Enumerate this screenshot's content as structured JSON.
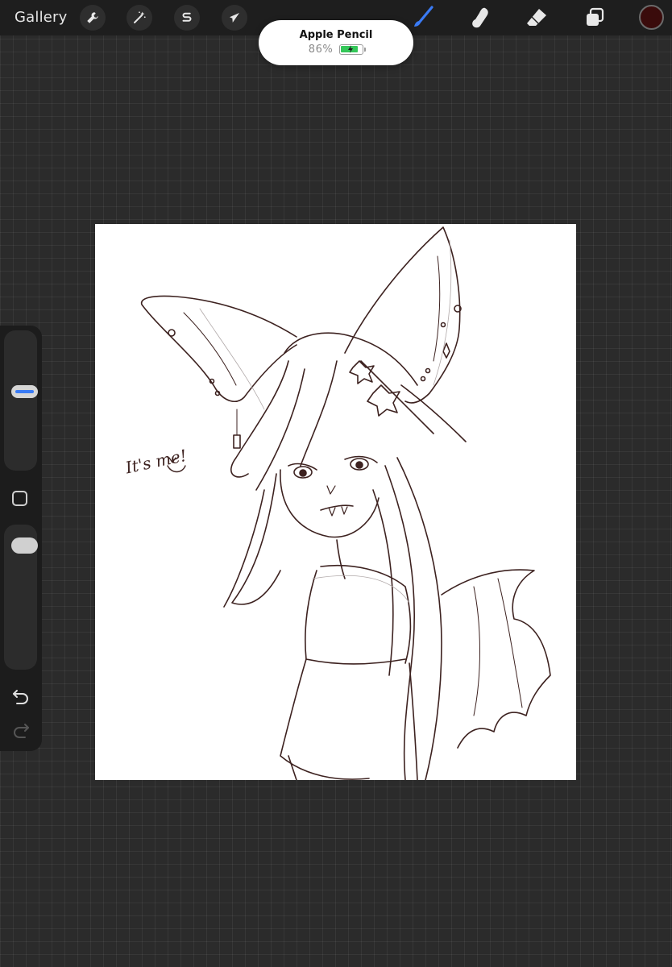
{
  "topbar": {
    "gallery_label": "Gallery",
    "left_tools": [
      {
        "name": "actions",
        "icon": "wrench-icon"
      },
      {
        "name": "adjustments",
        "icon": "magic-wand-icon"
      },
      {
        "name": "selection",
        "icon": "selection-s-icon"
      },
      {
        "name": "transform",
        "icon": "arrow-cursor-icon"
      }
    ],
    "right_tools": [
      {
        "name": "brush",
        "icon": "brush-icon",
        "active": true
      },
      {
        "name": "smudge",
        "icon": "smudge-finger-icon"
      },
      {
        "name": "eraser",
        "icon": "eraser-icon"
      },
      {
        "name": "layers",
        "icon": "layers-icon"
      }
    ],
    "current_color": "#3a0b0b",
    "accent": "#3a7bf5"
  },
  "pencil_popup": {
    "title": "Apple Pencil",
    "battery_percent_label": "86%",
    "battery_level": 0.86,
    "battery_color": "#34c759"
  },
  "canvas": {
    "artwork_text": "It's me!",
    "line_color": "#3d2220"
  },
  "sidebar": {
    "brush_size_level": 0.57,
    "opacity_level": 0.9,
    "undo_icon": "undo-icon",
    "redo_icon": "redo-icon",
    "modifier_icon": "square-modifier-icon"
  }
}
